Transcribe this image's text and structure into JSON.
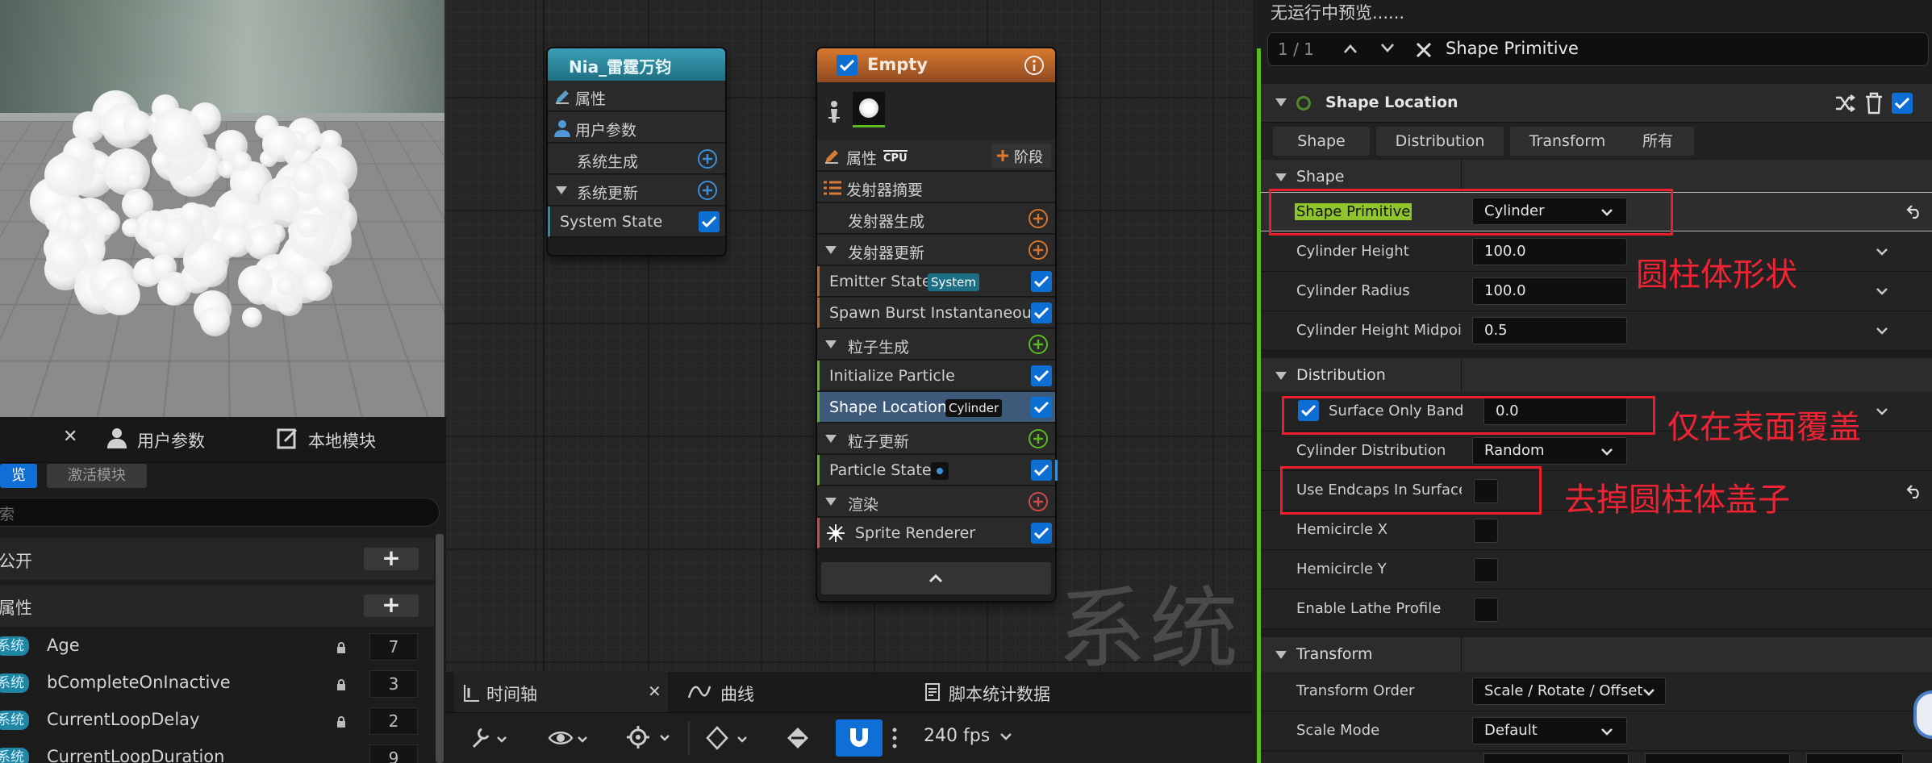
{
  "left": {
    "tabs": [
      {
        "label": ""
      },
      {
        "label": "用户参数"
      },
      {
        "label": "本地模块"
      }
    ],
    "subtabs": [
      "览",
      "激活模块"
    ],
    "search_placeholder": "索",
    "sections": [
      {
        "label": "公开"
      },
      {
        "label": "属性"
      }
    ],
    "badge_label": "系统",
    "attributes": [
      {
        "name": "Age",
        "value": "7"
      },
      {
        "name": "bCompleteOnInactive",
        "value": "3"
      },
      {
        "name": "CurrentLoopDelay",
        "value": "2"
      },
      {
        "name": "CurrentLoopDuration",
        "value": "9"
      }
    ]
  },
  "system_node": {
    "title": "Nia_雷霆万钧",
    "rows": [
      {
        "label": "属性"
      },
      {
        "label": "用户参数"
      },
      {
        "label": "系统生成"
      },
      {
        "label": "系统更新"
      },
      {
        "label": "System State"
      }
    ]
  },
  "emitter_node": {
    "title": "Empty",
    "props_label": "属性",
    "cpu_label": "CPU",
    "stage_label": "阶段",
    "summary_label": "发射器摘要",
    "rows": [
      {
        "label": "发射器生成"
      },
      {
        "label": "发射器更新"
      },
      {
        "label": "Emitter State",
        "badge": "System"
      },
      {
        "label": "Spawn Burst Instantaneous"
      },
      {
        "label": "粒子生成"
      },
      {
        "label": "Initialize Particle"
      },
      {
        "label": "Shape Location",
        "badge": "Cylinder"
      },
      {
        "label": "粒子更新"
      },
      {
        "label": "Particle State"
      },
      {
        "label": "渲染"
      },
      {
        "label": "Sprite Renderer"
      }
    ]
  },
  "watermark": "系统",
  "bottom": {
    "tabs": [
      {
        "label": "时间轴"
      },
      {
        "label": "曲线"
      },
      {
        "label": "脚本统计数据"
      }
    ],
    "fps": "240 fps"
  },
  "right": {
    "top_note": "无运行中预览......",
    "search": {
      "count": "1 / 1",
      "query": "Shape Primitive"
    },
    "module_title": "Shape Location",
    "filter_tabs": [
      "Shape",
      "Distribution",
      "Transform",
      "所有"
    ],
    "shape": {
      "header": "Shape",
      "rows": [
        {
          "label": "Shape Primitive",
          "value": "Cylinder"
        },
        {
          "label": "Cylinder Height",
          "value": "100.0"
        },
        {
          "label": "Cylinder Radius",
          "value": "100.0"
        },
        {
          "label": "Cylinder Height Midpoi",
          "value": "0.5"
        }
      ]
    },
    "distribution": {
      "header": "Distribution",
      "rows": [
        {
          "label": "Surface Only Band",
          "value": "0.0"
        },
        {
          "label": "Cylinder Distribution",
          "value": "Random"
        },
        {
          "label": "Use Endcaps In Surface"
        },
        {
          "label": "Hemicircle X"
        },
        {
          "label": "Hemicircle Y"
        },
        {
          "label": "Enable Lathe Profile"
        }
      ]
    },
    "transform": {
      "header": "Transform",
      "rows": [
        {
          "label": "Transform Order",
          "value": "Scale / Rotate / Offset"
        },
        {
          "label": "Scale Mode",
          "value": "Default"
        }
      ]
    },
    "annotations": [
      "圆柱体形状",
      "仅在表面覆盖",
      "去掉圆柱体盖子"
    ]
  },
  "colors": {
    "accent_blue": "#0f6fd6",
    "emitter_orange": "#c0662a",
    "system_teal": "#2a8fa6",
    "annotation_red": "#ee1d2d",
    "module_green": "#5bba1f"
  }
}
